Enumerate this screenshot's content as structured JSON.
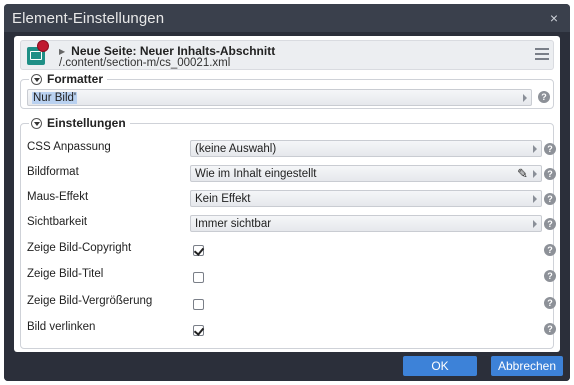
{
  "dialog": {
    "title": "Element-Einstellungen",
    "close_label": "×"
  },
  "resource": {
    "title": "Neue Seite: Neuer Inhalts-Abschnitt",
    "path": "/.content/section-m/cs_00021.xml"
  },
  "formatter": {
    "legend": "Formatter",
    "value": "Nur Bild'"
  },
  "settings": {
    "legend": "Einstellungen",
    "rows": [
      {
        "label": "CSS Anpassung",
        "type": "select",
        "value": "(keine Auswahl)"
      },
      {
        "label": "Bildformat",
        "type": "select",
        "value": "Wie im Inhalt eingestellt"
      },
      {
        "label": "Maus-Effekt",
        "type": "select",
        "value": "Kein Effekt"
      },
      {
        "label": "Sichtbarkeit",
        "type": "select",
        "value": "Immer sichtbar"
      },
      {
        "label": "Zeige Bild-Copyright",
        "type": "checkbox",
        "checked": true
      },
      {
        "label": "Zeige Bild-Titel",
        "type": "checkbox",
        "checked": false
      },
      {
        "label": "Zeige Bild-Vergrößerung",
        "type": "checkbox",
        "checked": false
      },
      {
        "label": "Bild verlinken",
        "type": "checkbox",
        "checked": true
      }
    ]
  },
  "help_label": "?",
  "buttons": {
    "ok": "OK",
    "cancel": "Abbrechen"
  },
  "colors": {
    "dialog_bg": "#2b2f3a",
    "titlebar_bg": "#3a404c",
    "button_primary": "#3d82d8",
    "resource_icon": "#1f8f86",
    "resource_badge": "#c0182f"
  },
  "icons": {
    "resource": "image-resource-icon",
    "menu": "hamburger-menu-icon",
    "help": "help-icon",
    "edit": "pencil-icon"
  }
}
